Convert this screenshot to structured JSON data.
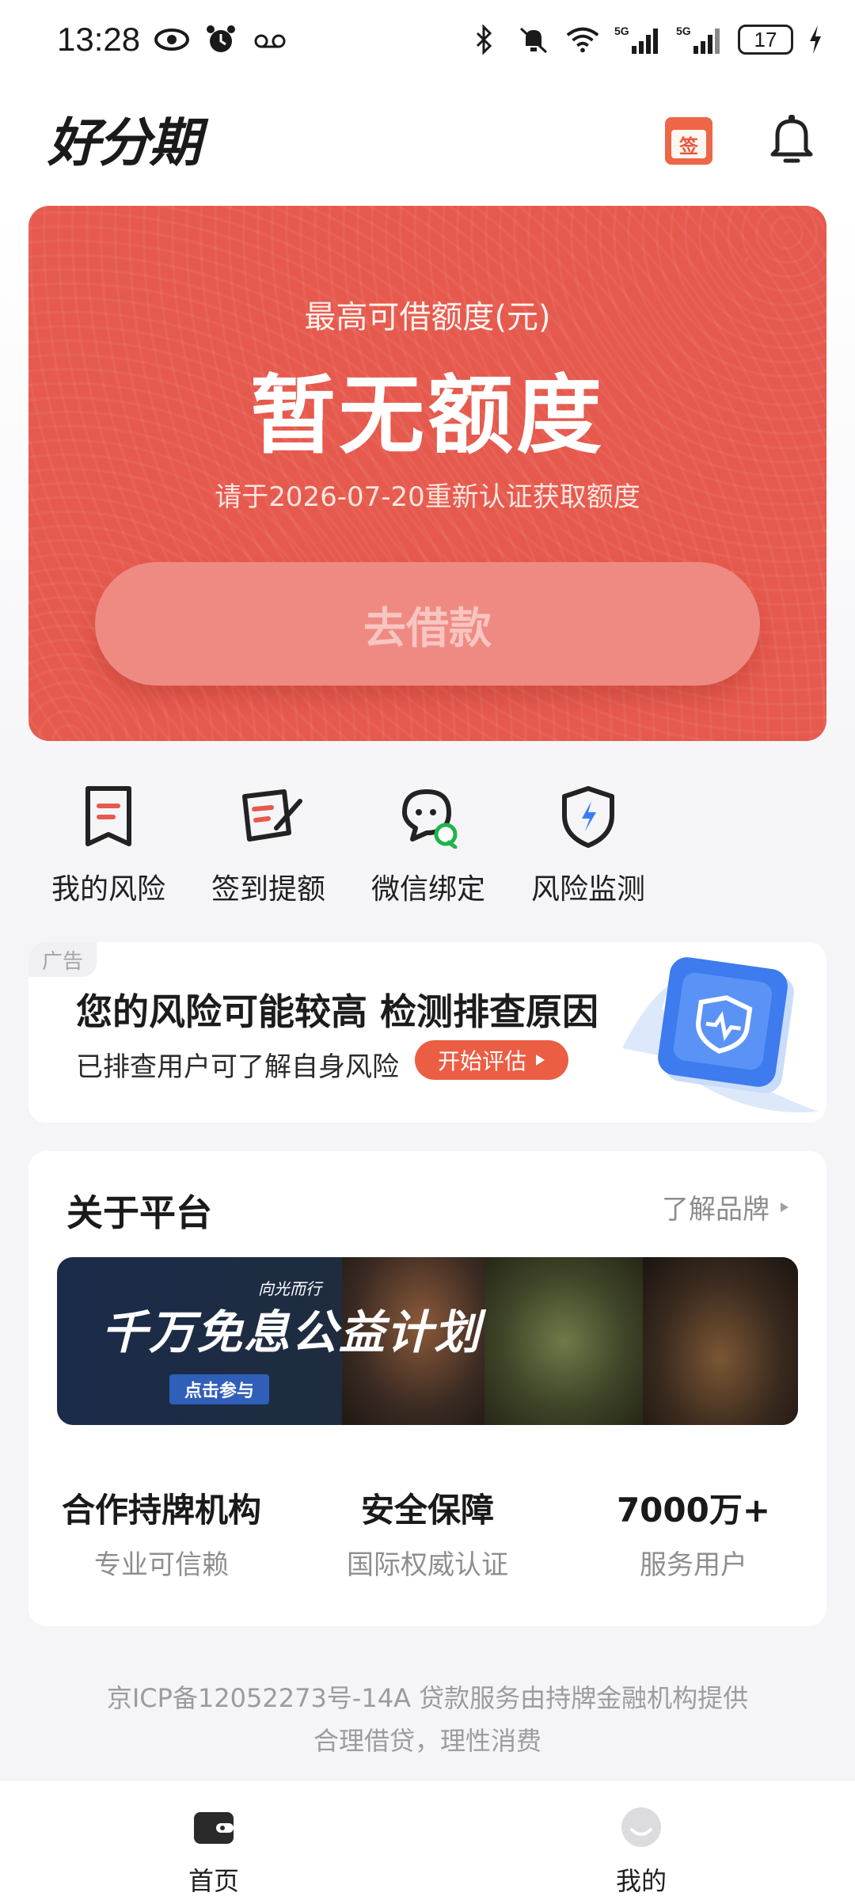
{
  "status_bar": {
    "time": "13:28",
    "battery": "17",
    "signal_label_1": "5G",
    "signal_label_2": "5G",
    "icons": [
      "eye-icon",
      "alarm-icon",
      "voicemail-icon",
      "bluetooth-icon",
      "mute-icon",
      "wifi-icon",
      "signal-icon",
      "battery-icon",
      "charging-icon"
    ]
  },
  "header": {
    "logo": "好分期",
    "sign_badge": "签",
    "icons": [
      "sign-in-calendar-icon",
      "bell-icon"
    ]
  },
  "credit": {
    "label": "最高可借额度(元)",
    "amount": "暂无额度",
    "note": "请于2026-07-20重新认证获取额度",
    "button": "去借款"
  },
  "quick_entries": [
    {
      "label": "我的风险",
      "icon": "bookmark-risk-icon"
    },
    {
      "label": "签到提额",
      "icon": "sign-pen-icon"
    },
    {
      "label": "微信绑定",
      "icon": "wechat-icon"
    },
    {
      "label": "风险监测",
      "icon": "shield-icon"
    }
  ],
  "ad": {
    "tag": "广告",
    "title": "您的风险可能较高 检测排查原因",
    "subtitle": "已排查用户可了解自身风险",
    "button": "开始评估",
    "icon": "shield-monitor-icon"
  },
  "about": {
    "title": "关于平台",
    "link": "了解品牌",
    "promo": {
      "title": "千万免息公益计划",
      "tagline": "向光而行",
      "cta": "点击参与"
    },
    "stats": [
      {
        "value": "合作持牌机构",
        "label": "专业可信赖"
      },
      {
        "value": "安全保障",
        "label": "国际权威认证"
      },
      {
        "value": "7000万+",
        "label": "服务用户"
      }
    ]
  },
  "footer": {
    "line1": "京ICP备12052273号-14A 贷款服务由持牌金融机构提供",
    "line2": "合理借贷，理性消费"
  },
  "bottom_nav": [
    {
      "label": "首页",
      "icon": "wallet-icon"
    },
    {
      "label": "我的",
      "icon": "profile-face-icon"
    }
  ],
  "colors": {
    "accent": "#e6594d",
    "button_pink": "#ef8a83",
    "ad_button": "#eb5e44",
    "background": "#f5f5f8"
  }
}
